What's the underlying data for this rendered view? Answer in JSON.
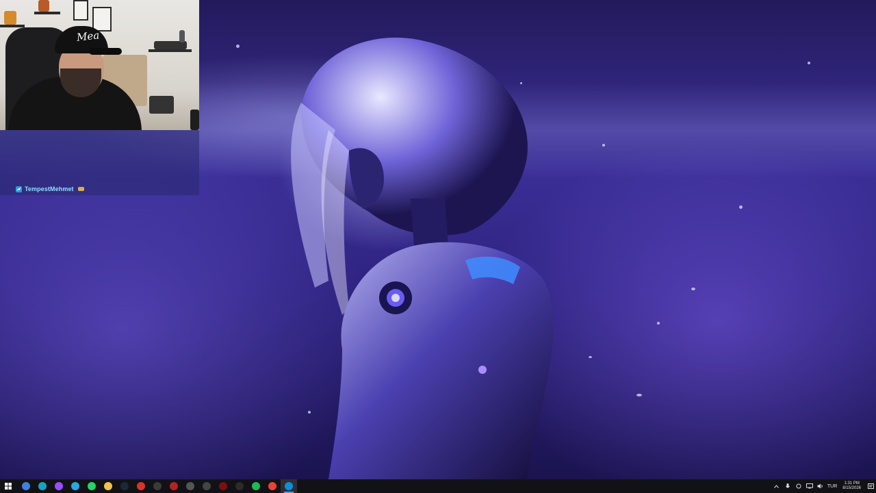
{
  "chat": {
    "username": "TempestMehmet",
    "name_color": "#8fe0ff"
  },
  "webcam": {
    "cap_text": "Mea"
  },
  "taskbar": {
    "start_icon": "windows-start-icon",
    "apps": [
      {
        "name": "app-1",
        "icon": "circle-app-icon",
        "color": "#3f7fe0"
      },
      {
        "name": "app-2",
        "icon": "browser-icon",
        "color": "#1aa0c0"
      },
      {
        "name": "app-3",
        "icon": "purple-app-icon",
        "color": "#9a4cff"
      },
      {
        "name": "app-4",
        "icon": "telegram-icon",
        "color": "#2ca5e0"
      },
      {
        "name": "app-5",
        "icon": "whatsapp-icon",
        "color": "#25d366"
      },
      {
        "name": "app-6",
        "icon": "folder-icon",
        "color": "#f2c14e"
      },
      {
        "name": "app-7",
        "icon": "steam-icon",
        "color": "#1b2838"
      },
      {
        "name": "app-8",
        "icon": "red-app-icon",
        "color": "#d9342b"
      },
      {
        "name": "app-9",
        "icon": "dark-app-icon",
        "color": "#3a3a3a"
      },
      {
        "name": "app-10",
        "icon": "tool-app-icon",
        "color": "#b02424"
      },
      {
        "name": "app-11",
        "icon": "hexagon-app-icon",
        "color": "#555555"
      },
      {
        "name": "app-12",
        "icon": "record-app-icon",
        "color": "#444444"
      },
      {
        "name": "app-13",
        "icon": "red-dark-app-icon",
        "color": "#7a1010"
      },
      {
        "name": "app-14",
        "icon": "capcut-icon",
        "color": "#2b2b2b"
      },
      {
        "name": "app-15",
        "icon": "spotify-icon",
        "color": "#1db954"
      },
      {
        "name": "app-16",
        "icon": "chrome-icon",
        "color": "#e94235"
      },
      {
        "name": "app-17",
        "icon": "edge-icon",
        "color": "#0c8fd8",
        "active": true
      }
    ],
    "tray": {
      "language": "TUR",
      "time": "1:31 PM",
      "date": "8/15/2026"
    }
  }
}
